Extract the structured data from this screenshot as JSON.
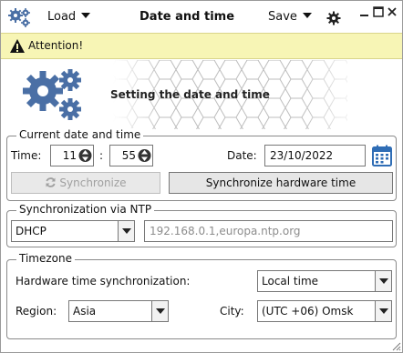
{
  "toolbar": {
    "load_label": "Load",
    "title": "Date and time",
    "save_label": "Save"
  },
  "attention": {
    "text": "Attention!"
  },
  "hero": {
    "title": "Setting the date and time"
  },
  "current": {
    "legend": "Current date and time",
    "time_label": "Time:",
    "hour": "11",
    "separator": ":",
    "minute": "55",
    "date_label": "Date:",
    "date_value": "23/10/2022",
    "sync_label": "Synchronize",
    "sync_hw_label": "Synchronize hardware time"
  },
  "ntp": {
    "legend": "Synchronization via NTP",
    "mode": "DHCP",
    "servers": "192.168.0.1,europa.ntp.org"
  },
  "timezone": {
    "legend": "Timezone",
    "hw_sync_label": "Hardware time synchronization:",
    "hw_sync_value": "Local time",
    "region_label": "Region:",
    "region_value": "Asia",
    "city_label": "City:",
    "city_value": "(UTC +06) Omsk"
  },
  "colors": {
    "gear_blue": "#4a6fa5",
    "attention_bg": "#f7f5b5",
    "calendar_blue": "#2f6db5"
  },
  "icons": [
    "gears-icon",
    "gear-icon",
    "warning-icon",
    "sync-icon",
    "calendar-icon",
    "minimize-icon",
    "maximize-icon",
    "close-icon"
  ]
}
